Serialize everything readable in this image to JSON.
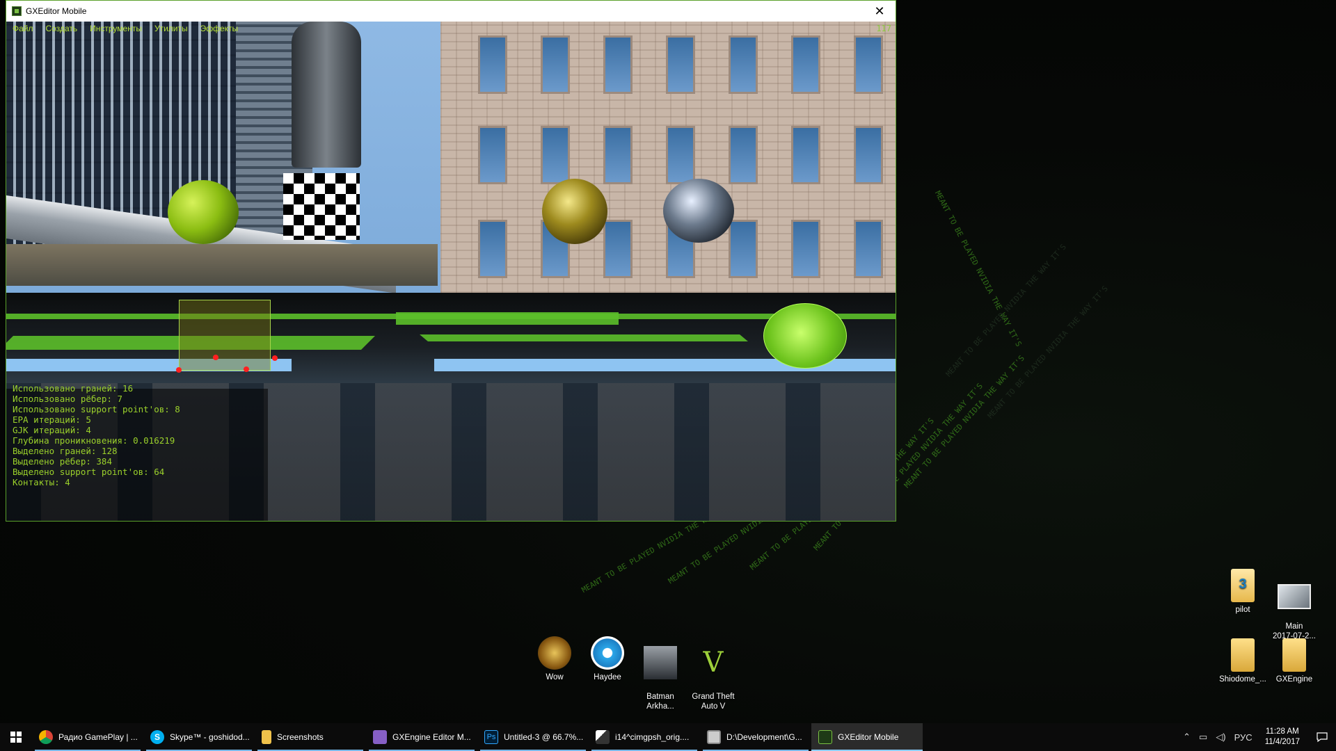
{
  "window": {
    "title": "GXEditor Mobile",
    "close_symbol": "✕",
    "menu": [
      "Файл",
      "Создать",
      "Инструменты",
      "Утилиты",
      "Эффекты"
    ],
    "fps": "117"
  },
  "stats": {
    "lines": [
      "Использовано граней: 16",
      "Использовано рёбер: 7",
      "Использовано support point'ов: 8",
      "EPA итераций: 5",
      "GJK итераций: 4",
      "Глубина проникновения: 0.016219",
      "Выделено граней: 128",
      "Выделено рёбер: 384",
      "Выделено support point'ов: 64",
      "Контакты: 4"
    ]
  },
  "desktop_icons": [
    {
      "label": "Wow",
      "icon": "wow-icon"
    },
    {
      "label": "Haydee",
      "icon": "haydee-icon"
    },
    {
      "label": "Batman\nArkha...",
      "icon": "batman-icon"
    },
    {
      "label": "Grand Theft\nAuto V",
      "icon": "gta-icon"
    },
    {
      "label": "pilot",
      "icon": "document-3-icon"
    },
    {
      "label": "Main\n2017-07-2...",
      "icon": "image-file-icon"
    },
    {
      "label": "Shiodome_...",
      "icon": "folder-icon"
    },
    {
      "label": "GXEngine",
      "icon": "folder-icon"
    }
  ],
  "wallpaper_text": "MEANT TO BE PLAYED NVIDIA THE WAY IT'S",
  "taskbar": {
    "items": [
      {
        "label": "Радио GamePlay | ...",
        "icon": "chrome-icon",
        "color": "#e8b02a"
      },
      {
        "label": "Skype™ - goshidod...",
        "icon": "skype-icon",
        "color": "#00aff0"
      },
      {
        "label": "Screenshots",
        "icon": "folder-icon",
        "color": "#f0c24b"
      },
      {
        "label": "GXEngine Editor M...",
        "icon": "visual-studio-icon",
        "color": "#865fc5"
      },
      {
        "label": "Untitled-3 @ 66.7%...",
        "icon": "photoshop-icon",
        "color": "#31a8ff"
      },
      {
        "label": "i14^cimgpsh_orig....",
        "icon": "image-viewer-icon",
        "color": "#dddddd"
      },
      {
        "label": "D:\\Development\\G...",
        "icon": "console-icon",
        "color": "#cccccc"
      },
      {
        "label": "GXEditor Mobile",
        "icon": "gxeditor-icon",
        "color": "#1e3a16",
        "active": true
      }
    ],
    "language": "РУС",
    "time": "11:28 AM",
    "date": "11/4/2017"
  },
  "colors": {
    "accent_green": "#9bd12b",
    "menu_text": "#b9e33a",
    "window_border": "#5aa12a"
  }
}
